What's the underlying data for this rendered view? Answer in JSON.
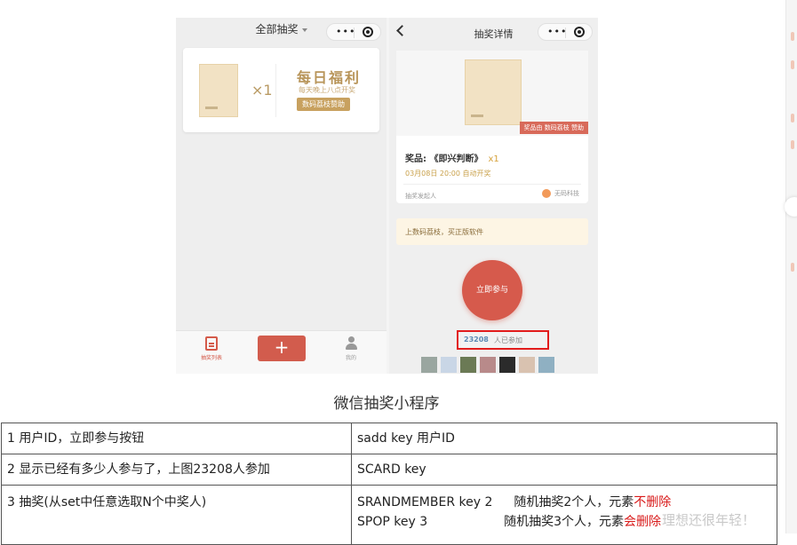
{
  "screenshot": {
    "left_phone": {
      "title": "全部抽奖",
      "card": {
        "quantity": "×1",
        "daily_title": "每日福利",
        "daily_sub": "每天晚上八点开奖",
        "sponsor": "数码荔枝赞助"
      },
      "tabbar": {
        "list_label": "抽奖列表",
        "plus": "+",
        "me_label": "我的"
      }
    },
    "right_phone": {
      "title": "抽奖详情",
      "prize_banner": "奖品由 数码荔枝 赞助",
      "prize_name": "奖品: 《即兴判断》",
      "prize_qty": "x1",
      "prize_time": "03月08日 20:00 自动开奖",
      "initiator_label": "抽奖发起人",
      "org_name": "无码科技",
      "notice": "上数码荔枝，买正版软件",
      "join_button": "立即参与",
      "participants_count": "23208",
      "participants_label": "人已参加"
    }
  },
  "caption": "微信抽奖小程序",
  "table": {
    "rows": [
      {
        "left": "1 用户ID，立即参与按钮",
        "right": "sadd key 用户ID"
      },
      {
        "left": "2 显示已经有多少人参与了，上图23208人参加",
        "right": "SCARD key"
      },
      {
        "left": "3 抽奖(从set中任意选取N个中奖人)",
        "right_lines": [
          {
            "cmd": "SRANDMEMBER key 2",
            "desc": "随机抽奖2个人，元素",
            "highlight": "不删除"
          },
          {
            "cmd": "SPOP  key 3",
            "desc": "随机抽奖3个人，元素",
            "highlight": "会删除"
          }
        ]
      }
    ]
  },
  "watermark": "理想还很年轻！",
  "colors": {
    "accent_red": "#d65a4c",
    "gold": "#b8955a",
    "highlight_red": "#d91b1b",
    "count_blue": "#5b8ab5"
  }
}
